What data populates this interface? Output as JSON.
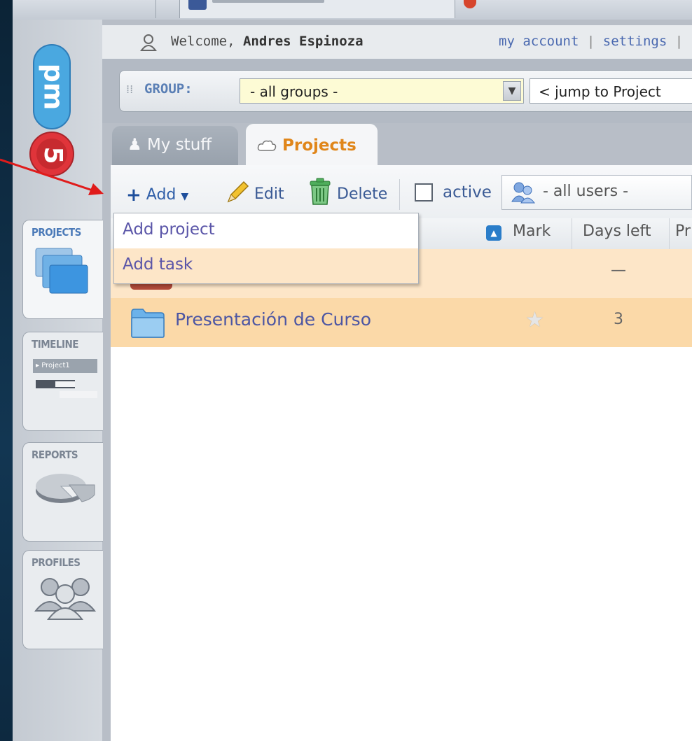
{
  "user": {
    "welcome_prefix": "Welcome,",
    "name": "Andres Espinoza"
  },
  "account_links": {
    "my_account": "my account",
    "separator": "|",
    "settings": "settings",
    "trailing": "|"
  },
  "group_bar": {
    "label": "GROUP:",
    "group_select_value": "- all groups -",
    "jump_select_value": "< jump to Project"
  },
  "tabs": [
    {
      "label": "My stuff",
      "icon": "person-icon"
    },
    {
      "label": "Projects",
      "icon": "cloud-icon"
    }
  ],
  "toolbar": {
    "add_label": "Add",
    "edit_label": "Edit",
    "delete_label": "Delete",
    "active_label": "active",
    "users_select_value": "- all users -"
  },
  "add_menu": {
    "items": [
      "Add project",
      "Add task"
    ]
  },
  "table": {
    "headers": [
      "Mark",
      "Days left",
      "Pr"
    ],
    "rows": [
      {
        "name": "",
        "days_left": "—"
      },
      {
        "name": "Presentación de Curso",
        "days_left": "3"
      }
    ]
  },
  "sidebar": {
    "items": [
      {
        "label": "PROJECTS",
        "icon": "folders-icon"
      },
      {
        "label": "TIMELINE",
        "icon": "gantt-icon",
        "art_text": "▸ Project1"
      },
      {
        "label": "REPORTS",
        "icon": "pie-chart-icon"
      },
      {
        "label": "PROFILES",
        "icon": "people-icon"
      }
    ]
  },
  "colors": {
    "accent_orange": "#e0861a",
    "link_blue": "#4a69b0",
    "row_highlight": "#fbd9a8"
  }
}
